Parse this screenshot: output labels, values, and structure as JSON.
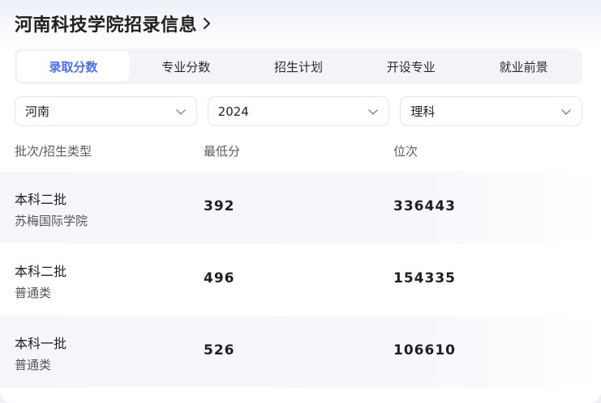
{
  "header": {
    "title": "河南科技学院招录信息"
  },
  "tabs": [
    {
      "label": "录取分数",
      "active": true
    },
    {
      "label": "专业分数",
      "active": false
    },
    {
      "label": "招生计划",
      "active": false
    },
    {
      "label": "开设专业",
      "active": false
    },
    {
      "label": "就业前景",
      "active": false
    }
  ],
  "filters": {
    "province": "河南",
    "year": "2024",
    "subject": "理科"
  },
  "table": {
    "columns": [
      "批次/招生类型",
      "最低分",
      "位次"
    ],
    "rows": [
      {
        "batch": "本科二批",
        "type": "苏梅国际学院",
        "min_score": "392",
        "rank": "336443"
      },
      {
        "batch": "本科二批",
        "type": "普通类",
        "min_score": "496",
        "rank": "154335"
      },
      {
        "batch": "本科一批",
        "type": "普通类",
        "min_score": "526",
        "rank": "106610"
      }
    ]
  },
  "colors": {
    "accent": "#4c6ef5",
    "tab_bg": "#f3f4f8",
    "row_shade": "#f5f6fb"
  }
}
